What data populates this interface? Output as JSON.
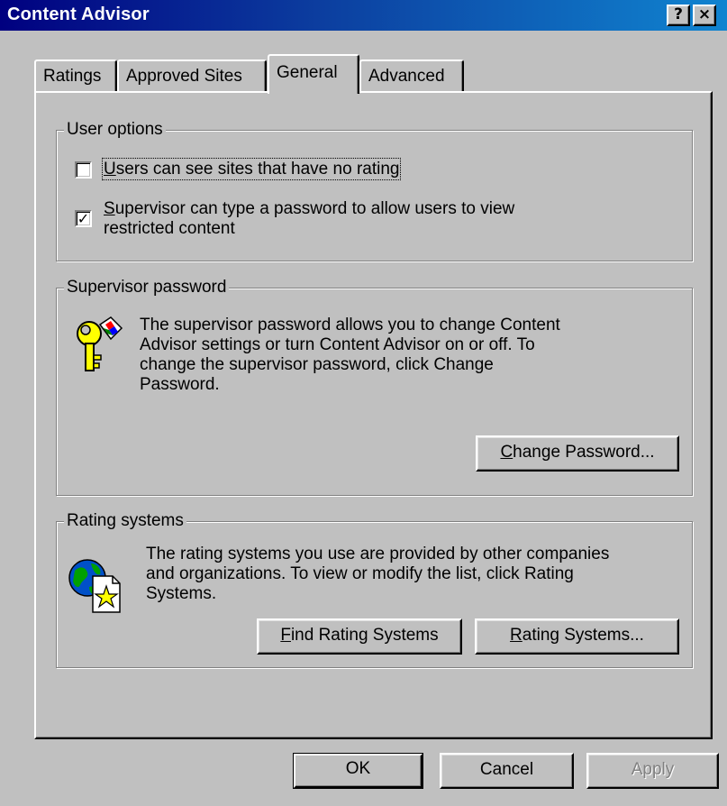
{
  "window": {
    "title": "Content Advisor",
    "help_label": "?",
    "close_label": "×"
  },
  "tabs": [
    {
      "label": "Ratings",
      "active": false
    },
    {
      "label": "Approved Sites",
      "active": false
    },
    {
      "label": "General",
      "active": true
    },
    {
      "label": "Advanced",
      "active": false
    }
  ],
  "user_options": {
    "legend": "User options",
    "checkbox1": {
      "mnemonic": "U",
      "rest": "sers can see sites that have no rating",
      "checked": false
    },
    "checkbox2": {
      "mnemonic": "S",
      "line1_rest": "upervisor can type a password to allow users to view",
      "line2": "restricted content",
      "checked": true
    }
  },
  "supervisor_password": {
    "legend": "Supervisor password",
    "description": [
      "The supervisor password allows you to change Content",
      "Advisor settings or turn Content Advisor on or off. To",
      "change the supervisor password, click Change",
      "Password."
    ],
    "icon": "key-icon",
    "change_button": {
      "mnemonic": "C",
      "rest": "hange Password..."
    }
  },
  "rating_systems": {
    "legend": "Rating systems",
    "description": [
      "The rating systems you use are provided by other companies",
      "and organizations. To view or modify the list, click Rating",
      "Systems."
    ],
    "icon": "globe-document-icon",
    "find_button": {
      "mnemonic": "F",
      "rest": "ind Rating Systems"
    },
    "rating_button": {
      "mnemonic": "R",
      "rest": "ating Systems..."
    }
  },
  "buttons": {
    "ok": "OK",
    "cancel": "Cancel",
    "apply": "Apply"
  },
  "colors": {
    "titlebar_start": "#000080",
    "titlebar_end": "#1084d0",
    "face": "#c0c0c0"
  }
}
